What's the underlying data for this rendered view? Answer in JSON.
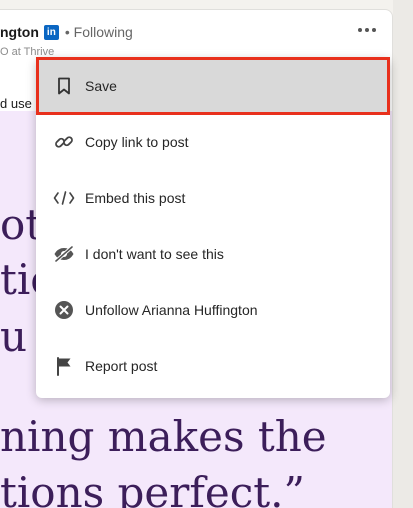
{
  "post": {
    "author_name": "ngton",
    "network_badge": "in",
    "follow_status": "• Following",
    "author_subtitle": "O at Thrive",
    "text_snippet": "d use",
    "quote_lines": [
      "ot w",
      "tic",
      "u t",
      "ning makes the",
      "tions perfect.”"
    ]
  },
  "menu": {
    "items": [
      {
        "label": "Save",
        "icon": "bookmark-icon"
      },
      {
        "label": "Copy link to post",
        "icon": "link-icon"
      },
      {
        "label": "Embed this post",
        "icon": "code-icon"
      },
      {
        "label": "I don't want to see this",
        "icon": "eye-slash-icon"
      },
      {
        "label": "Unfollow Arianna Huffington",
        "icon": "close-circle-icon"
      },
      {
        "label": "Report post",
        "icon": "flag-icon"
      }
    ],
    "selected_index": 0
  },
  "colors": {
    "highlight": "#e8301c",
    "quote_background": "#f4e8fb",
    "quote_text": "#3c1e5a",
    "linkedin_blue": "#0a66c2"
  }
}
